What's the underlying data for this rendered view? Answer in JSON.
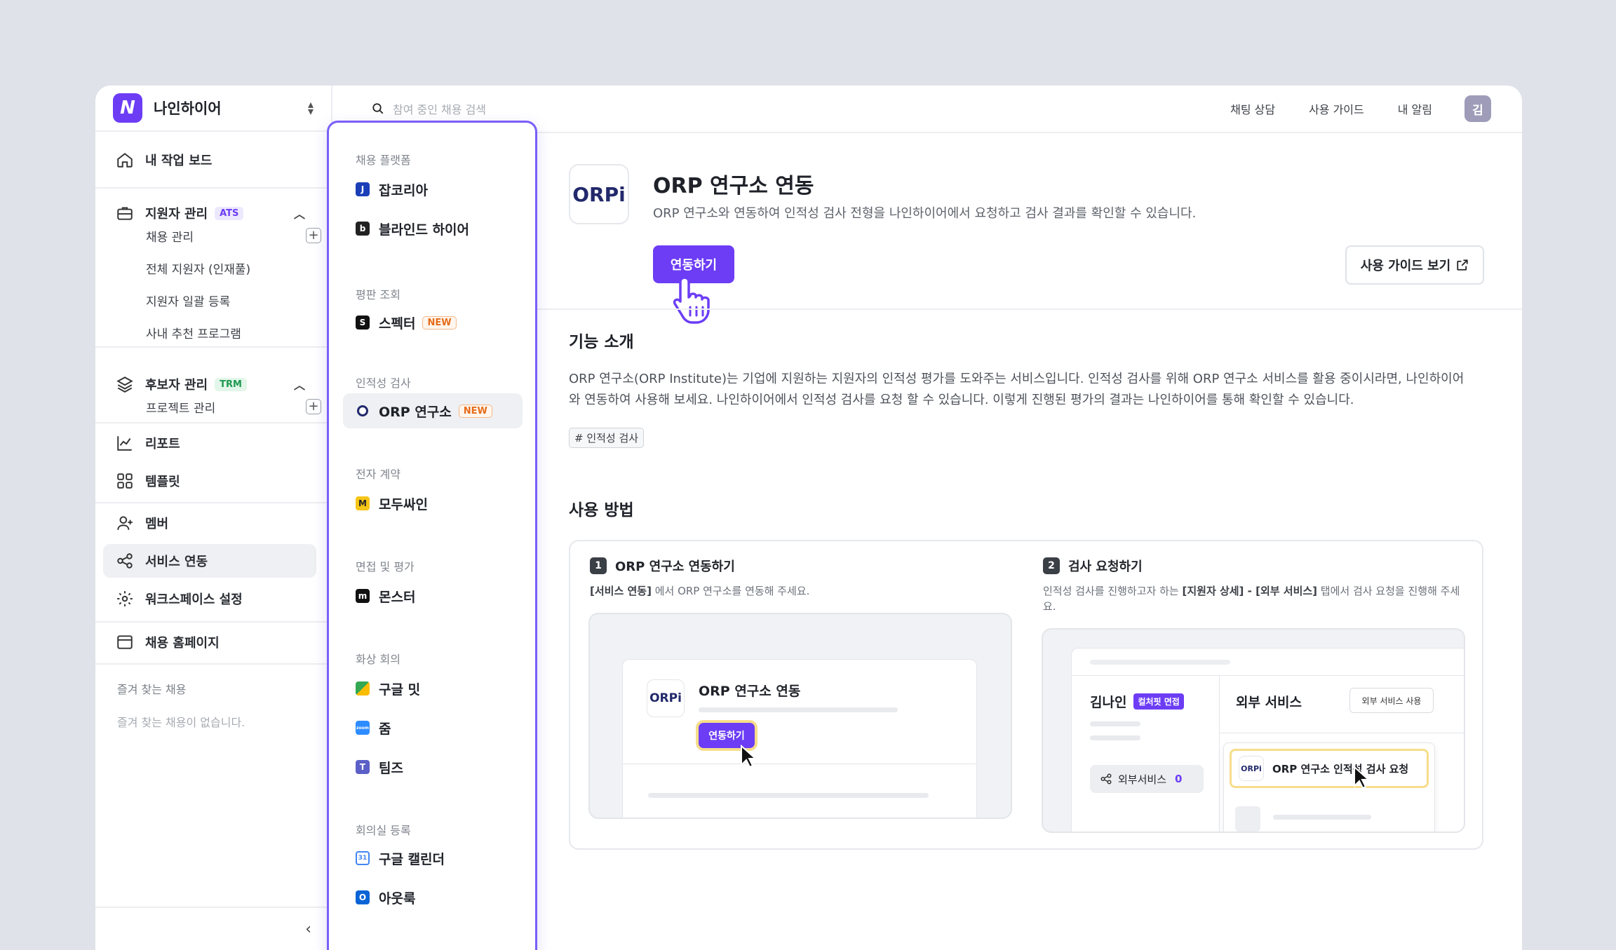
{
  "brand": {
    "name": "나인하이어",
    "logo": "N"
  },
  "sidebar": {
    "dashboard": "내 작업 보드",
    "applicants": {
      "label": "지원자 관리",
      "badge": "ATS",
      "subs": [
        "채용 관리",
        "전체 지원자 (인재풀)",
        "지원자 일괄 등록",
        "사내 추천 프로그램"
      ]
    },
    "candidates": {
      "label": "후보자 관리",
      "badge": "TRM",
      "subs": [
        "프로젝트 관리"
      ]
    },
    "report": "리포트",
    "template": "템플릿",
    "member": "멤버",
    "integration": "서비스 연동",
    "workspace": "워크스페이스 설정",
    "homepage": "채용 홈페이지",
    "favorites_title": "즐겨 찾는 채용",
    "favorites_empty": "즐겨 찾는 채용이 없습니다."
  },
  "topbar": {
    "search_placeholder": "참여 중인 채용 검색",
    "links": [
      "채팅 상담",
      "사용 가이드",
      "내 알림"
    ],
    "avatar": "김"
  },
  "panel": {
    "groups": [
      {
        "title": "채용 플랫폼",
        "items": [
          "잡코리아",
          "블라인드 하이어"
        ]
      },
      {
        "title": "평판 조회",
        "items": [
          "스펙터"
        ]
      },
      {
        "title": "인적성 검사",
        "items": [
          "ORP 연구소"
        ]
      },
      {
        "title": "전자 계약",
        "items": [
          "모두싸인"
        ]
      },
      {
        "title": "면접 및 평가",
        "items": [
          "몬스터"
        ]
      },
      {
        "title": "화상 회의",
        "items": [
          "구글 밋",
          "줌",
          "팀즈"
        ]
      },
      {
        "title": "회의실 등록",
        "items": [
          "구글 캘린더",
          "아웃룩"
        ]
      }
    ],
    "new_badge": "NEW",
    "icon_letters": {
      "jobkorea": "J",
      "blind": "b",
      "specter": "S",
      "orp": "O",
      "modusign": "M",
      "monster": "m",
      "zoom": "zoom",
      "teams": "T",
      "gcal": "31",
      "outlook": "O"
    }
  },
  "main": {
    "logo": "ORPi",
    "title": "ORP 연구소 연동",
    "description": "ORP 연구소와 연동하여 인적성 검사 전형을 나인하이어에서 요청하고 검사 결과를 확인할 수 있습니다.",
    "connect_label": "연동하기",
    "guide_label": "사용 가이드 보기",
    "intro_title": "기능 소개",
    "intro_text": "ORP 연구소(ORP Institute)는 기업에 지원하는 지원자의 인적성 평가를 도와주는 서비스입니다. 인적성 검사를 위해 ORP 연구소 서비스를 활용 중이시라면, 나인하이어와 연동하여 사용해 보세요. 나인하이어에서 인적성 검사를 요청 할 수 있습니다. 이렇게 진행된 평가의 결과는 나인하이어를 통해 확인할 수 있습니다.",
    "tag": "# 인적성 검사",
    "howto_title": "사용 방법",
    "step1": {
      "num": "1",
      "title": "ORP 연구소 연동하기",
      "desc_bold": "[서비스 연동]",
      "desc": " 에서 ORP 연구소를 연동해 주세요.",
      "card_title": "ORP 연구소 연동",
      "btn": "연동하기",
      "logo": "ORPi"
    },
    "step2": {
      "num": "2",
      "title": "검사 요청하기",
      "desc_pre": "인적성 검사를 진행하고자 하는 ",
      "desc_bold": "[지원자 상세] - [외부 서비스]",
      "desc_post": " 탭에서 검사 요청을 진행해 주세요.",
      "name": "김나인",
      "stage": "컬처핏 면접",
      "ext_tab": "외부서비스",
      "ext_count": "0",
      "ext_title": "외부 서비스",
      "ext_btn": "외부 서비스 사용",
      "request": "ORP 연구소 인적성 검사 요청",
      "logo": "ORPi"
    }
  },
  "colors": {
    "accent": "#6c3df5",
    "highlight": "#f7dd8a",
    "new": "#e56c1a"
  }
}
